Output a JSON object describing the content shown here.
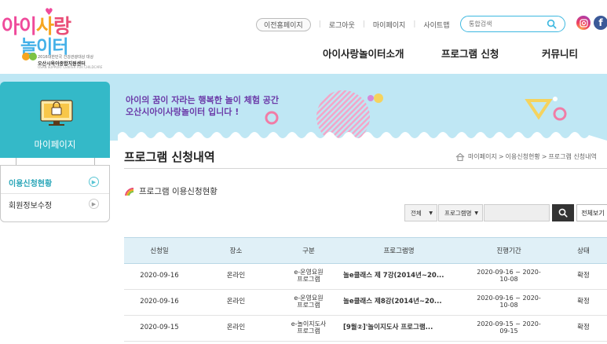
{
  "logo": {
    "line1": [
      "아이",
      "사",
      "랑"
    ],
    "line2": "놀이터",
    "sub1": "2016대한민국 건강관광대상 대상",
    "sub2": "오산시육아종합지원센터",
    "sub3": "OSAN SUPPORT CENTER FOR CHILDCARE"
  },
  "topbar": {
    "prev_home": "이전홈페이지",
    "logout": "로그아웃",
    "mypage": "마이페이지",
    "sitemap": "사이트맵",
    "search_placeholder": "통합검색"
  },
  "gnb": {
    "items": [
      "아이사랑놀이터소개",
      "프로그램 신청",
      "커뮤니티"
    ]
  },
  "banner": {
    "line1": "아이의 꿈이 자라는 행복한 놀이 체험 공간",
    "line2": "오산시아이사랑놀이터 입니다 !"
  },
  "sidebar": {
    "title": "마이페이지",
    "items": [
      {
        "label": "이용신청현황",
        "active": true
      },
      {
        "label": "회원정보수정",
        "active": false
      }
    ]
  },
  "content": {
    "page_title": "프로그램 신청내역",
    "breadcrumb": [
      "마이페이지",
      "이용신청현황",
      "프로그램 신청내역"
    ],
    "breadcrumb_sep": ">",
    "section_title": "프로그램 이용신청현황",
    "filter": {
      "select1": "전체",
      "select2": "프로그램명",
      "view_all": "전체보기"
    }
  },
  "table": {
    "headers": [
      "신청일",
      "장소",
      "구분",
      "프로그램명",
      "진행기간",
      "상태"
    ],
    "rows": [
      [
        "2020-09-16",
        "온라인",
        "e-운영요원\n프로그램",
        "놀e클래스 제 7강(2014년~20...",
        "2020-09-16 ~ 2020-\n10-08",
        "확정"
      ],
      [
        "2020-09-16",
        "온라인",
        "e-운영요원\n프로그램",
        "놀e클래스 제8강(2014년~20...",
        "2020-09-16 ~ 2020-\n10-08",
        "확정"
      ],
      [
        "2020-09-15",
        "온라인",
        "e-놀이지도사\n프로그램",
        "[9월②]'놀이지도사 프로그램...",
        "2020-09-15 ~ 2020-\n09-15",
        "확정"
      ]
    ]
  },
  "colors": {
    "accent": "#34b9c8",
    "banner_bg": "#bfe7f4",
    "banner_text": "#6b3aa8",
    "table_header_bg": "#e0f0f7"
  }
}
